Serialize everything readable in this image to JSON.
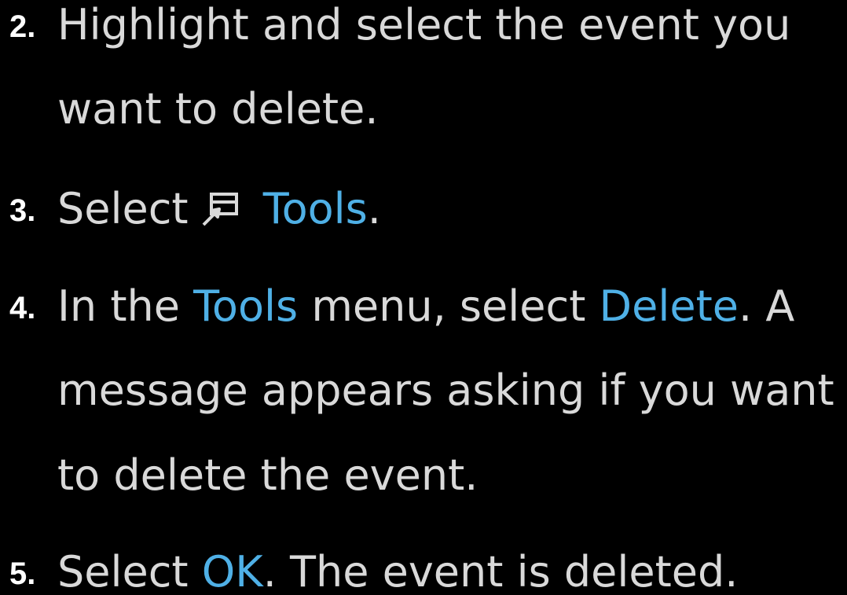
{
  "colors": {
    "background": "#000000",
    "text": "#d9d9d9",
    "step_number": "#ffffff",
    "highlight": "#4fb0e6"
  },
  "steps": [
    {
      "number": "2.",
      "line1": "Highlight and select the event you",
      "line2": "want to delete."
    },
    {
      "number": "3.",
      "select": "Select",
      "icon": "tools-icon",
      "tools": "Tools",
      "period": "."
    },
    {
      "number": "4.",
      "in_the": "In the",
      "tools": "Tools",
      "menu_select": "menu, select",
      "delete": "Delete",
      "after": ". A",
      "line2": "message appears asking if you want",
      "line3": "to delete the event."
    },
    {
      "number": "5.",
      "select": "Select",
      "ok": "OK",
      "after": ". The event is deleted."
    }
  ]
}
